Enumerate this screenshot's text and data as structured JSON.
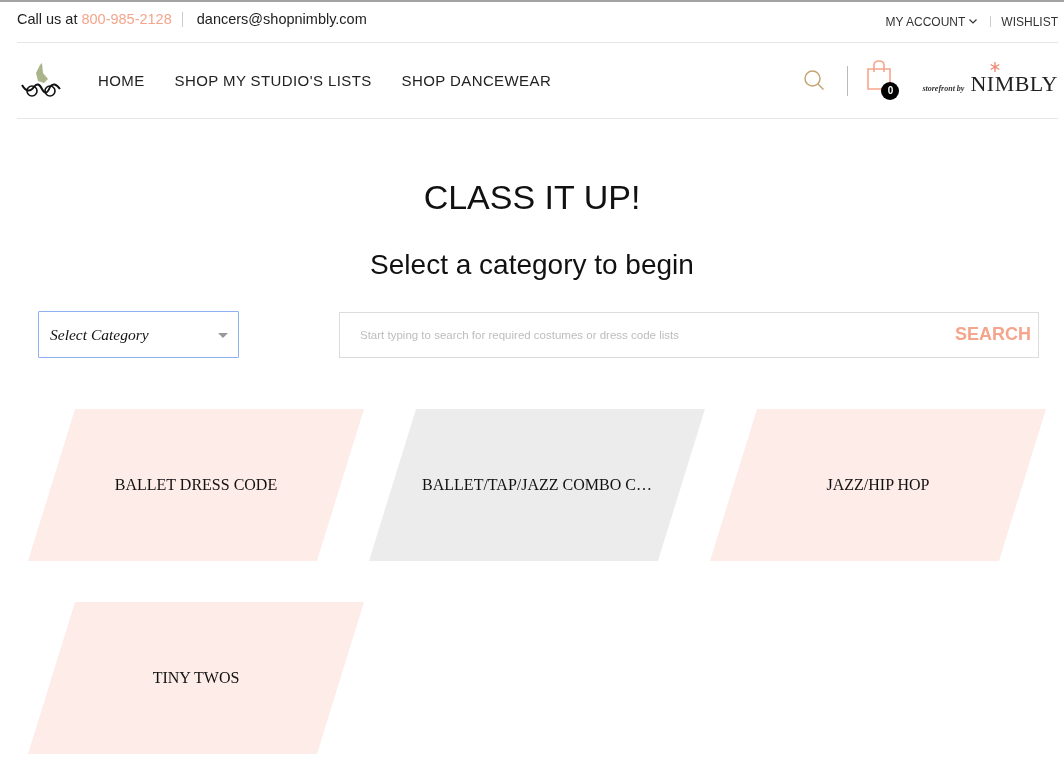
{
  "top_bar": {
    "contact_label": "Call us at",
    "phone": "800-985-2128",
    "email": "dancers@shopnimbly.com",
    "account_menu": "MY ACCOUNT",
    "wishlist": "WISHLIST"
  },
  "nav": {
    "items": [
      "HOME",
      "SHOP MY STUDIO'S LISTS",
      "SHOP DANCEWEAR"
    ],
    "cart_count": "0",
    "storefront_label": "storefront by",
    "brand": "NIMBLY"
  },
  "hero": {
    "title": "CLASS IT UP!",
    "subtitle": "Select a category to begin"
  },
  "category_select": {
    "value": "Select Category"
  },
  "search": {
    "placeholder": "Start typing to search for required costumes or dress code lists",
    "button": "SEARCH"
  },
  "categories": [
    {
      "label": "BALLET DRESS CODE",
      "color": "#fdece8"
    },
    {
      "label": "BALLET/TAP/JAZZ COMBO C…",
      "color": "#ebeceb"
    },
    {
      "label": "JAZZ/HIP HOP",
      "color": "#fdece8"
    },
    {
      "label": "TINY TWOS",
      "color": "#fdece8"
    }
  ]
}
